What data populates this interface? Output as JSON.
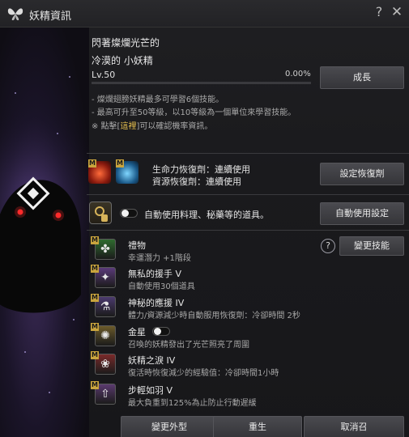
{
  "window": {
    "title": "妖精資訊",
    "help": "?",
    "close": "✕"
  },
  "fairy": {
    "name_line1": "閃著燦爛光芒的",
    "name_line2": "冷漠的 小妖精",
    "level": "Lv.50",
    "exp_percent": "0.00%",
    "exp_fraction": 0.0
  },
  "buttons": {
    "grow": "成長",
    "set_potion": "設定恢復劑",
    "auto_use_settings": "自動使用設定",
    "change_skill": "變更技能",
    "change_look": "變更外型",
    "rebirth": "重生",
    "cancel": "取消召"
  },
  "notes": {
    "line1": "- 燦爛翅膀妖精最多可學習6個技能。",
    "line2": "- 最高可升至50等級，以10等級為一個單位來學習技能。",
    "line3_prefix": "※ 點擊[",
    "line3_link": "這裡",
    "line3_suffix": "]可以確認機率資訊。"
  },
  "potions": {
    "hp_label": "生命力恢復劑：連續使用",
    "mp_label": "資源恢復劑：連續使用"
  },
  "auto_use": {
    "label": "自動使用料理、秘藥等的道具。",
    "enabled": false
  },
  "skills": [
    {
      "name": "禮物",
      "desc": "幸運潛力 +1階段",
      "icon": "clover-icon"
    },
    {
      "name": "無私的援手 V",
      "desc": "自動使用30個道具",
      "icon": "fairy-icon"
    },
    {
      "name": "神秘的應援 IV",
      "desc": "體力/資源減少時自動服用恢復劑：冷卻時間 2秒",
      "icon": "potion-icon"
    },
    {
      "name": "金星",
      "desc": "召喚的妖精發出了光芒照亮了周圍",
      "icon": "lantern-icon"
    },
    {
      "name": "妖精之淚 IV",
      "desc": "復活時恢復減少的經驗值：冷卻時間1小時",
      "icon": "tear-icon"
    },
    {
      "name": "步輕如羽 V",
      "desc": "最大負重到125%為止防止行動遲緩",
      "icon": "weight-icon"
    }
  ],
  "skill_badge": "M",
  "colors": {
    "accent_gold": "#c9a43d",
    "link": "#e7c04f"
  }
}
